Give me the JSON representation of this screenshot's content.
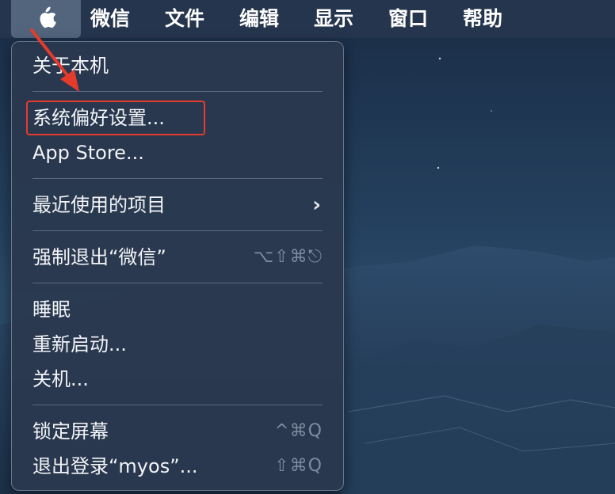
{
  "menubar": {
    "apple_icon": "apple-logo-icon",
    "items": [
      {
        "label": "微信"
      },
      {
        "label": "文件"
      },
      {
        "label": "编辑"
      },
      {
        "label": "显示"
      },
      {
        "label": "窗口"
      },
      {
        "label": "帮助"
      }
    ]
  },
  "apple_menu": {
    "about": "关于本机",
    "system_prefs": "系统偏好设置...",
    "app_store": "App Store...",
    "recent_items": "最近使用的项目",
    "recent_chevron": "›",
    "force_quit": "强制退出“微信”",
    "force_quit_shortcut": "⌥⇧⌘⎋",
    "sleep": "睡眠",
    "restart": "重新启动...",
    "shutdown": "关机...",
    "lock_screen": "锁定屏幕",
    "lock_shortcut": "^⌘Q",
    "logout": "退出登录“myos”...",
    "logout_shortcut": "⇧⌘Q"
  },
  "colors": {
    "annotation": "#e53b2b",
    "menubar": "#26364e",
    "menu_bg": "#2a384e"
  }
}
